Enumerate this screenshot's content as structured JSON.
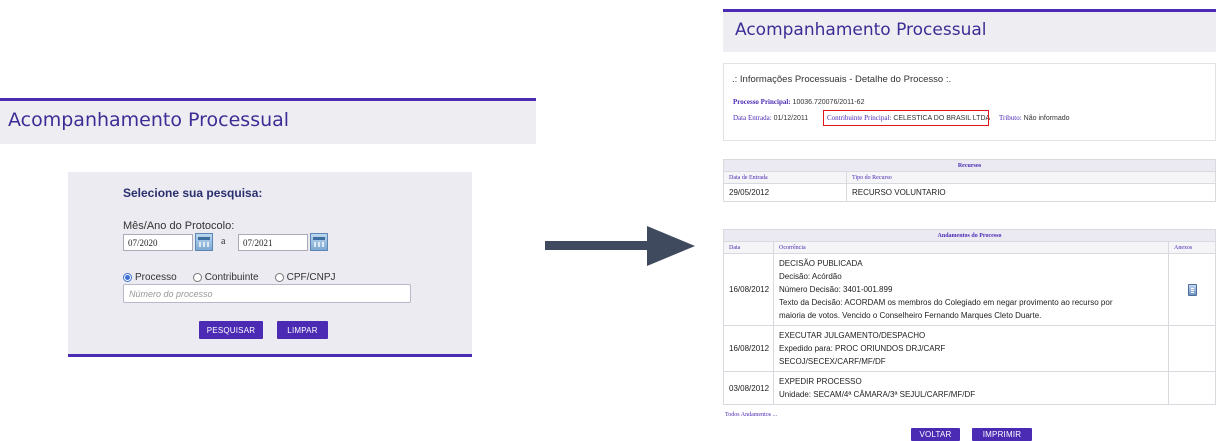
{
  "left": {
    "header_title": "Acompanhamento Processual",
    "search_heading": "Selecione sua pesquisa:",
    "date_label": "Mês/Ano do Protocolo:",
    "date_from": "07/2020",
    "date_separator": "a",
    "date_to": "07/2021",
    "radios": [
      {
        "label": "Processo",
        "selected": true
      },
      {
        "label": "Contribuinte",
        "selected": false
      },
      {
        "label": "CPF/CNPJ",
        "selected": false
      }
    ],
    "process_placeholder": "Número do processo",
    "search_button": "PESQUISAR",
    "clear_button": "LIMPAR"
  },
  "right": {
    "header_title": "Acompanhamento Processual",
    "info": {
      "title": ".: Informações Processuais - Detalhe do Processo :.",
      "processo_label": "Processo Principal:",
      "processo_value": "10036.720076/2011-62",
      "data_label": "Data Entrada:",
      "data_value": "01/12/2011",
      "contribuinte_label": "Contribuinte Principal:",
      "contribuinte_value": "CELESTICA DO BRASIL LTDA",
      "tributo_label": "Tributo:",
      "tributo_value": "Não informado"
    },
    "recursos": {
      "title": "Recursos",
      "columns": [
        "Data de Entrada",
        "Tipo do Recurso"
      ],
      "rows": [
        [
          "29/05/2012",
          "RECURSO VOLUNTARIO"
        ]
      ]
    },
    "andamentos": {
      "title": "Andamentos do Processo",
      "columns": [
        "Data",
        "Ocorrência",
        "Anexos"
      ],
      "rows": [
        {
          "date": "16/08/2012",
          "lines": [
            "DECISÃO PUBLICADA",
            "Decisão: Acórdão",
            "Número Decisão: 3401-001.899",
            "Texto da Decisão: ACORDAM os membros do Colegiado em negar provimento ao recurso por",
            "maioria de votos. Vencido o Conselheiro Fernando Marques Cleto Duarte."
          ]
        },
        {
          "date": "16/08/2012",
          "lines": [
            "EXECUTAR JULGAMENTO/DESPACHO",
            "Expedido para: PROC ORIUNDOS DRJ/CARF",
            "SECOJ/SECEX/CARF/MF/DF"
          ]
        },
        {
          "date": "03/08/2012",
          "lines": [
            "EXPEDIR PROCESSO",
            "Unidade: SECAM/4ª CÂMARA/3ª SEJUL/CARF/MF/DF"
          ]
        }
      ]
    },
    "todos_link": "Todos Andamentos ...",
    "voltar_button": "VOLTAR",
    "imprimir_button": "IMPRIMIR"
  },
  "colors": {
    "accent": "#4b2bb3",
    "title": "#3c2d96",
    "highlight": "#e0161d",
    "arrow": "#3f4a5f"
  }
}
